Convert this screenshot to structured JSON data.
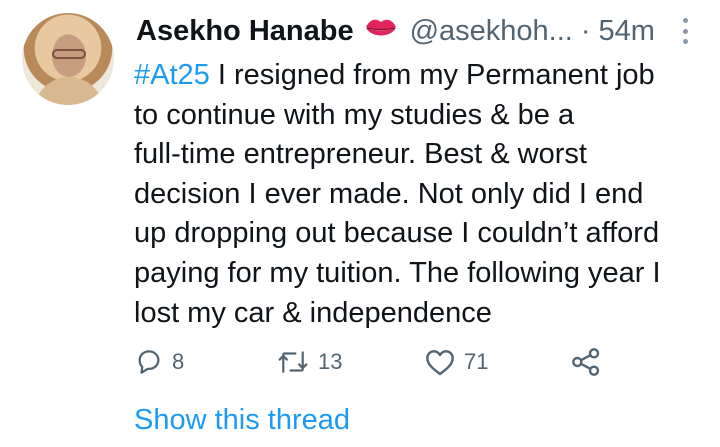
{
  "tweet": {
    "author_name": "Asekho Hanabe",
    "author_emoji_icon": "kiss-mark-icon",
    "handle": "@asekhoh...",
    "separator": "·",
    "time": "54m",
    "hashtag": "#At25",
    "lines": [
      " I resigned from my Permanent job",
      "to continue with my studies & be a",
      "full-time entrepreneur. Best & worst",
      "decision I ever made. Not only did I end",
      "up dropping out because I couldn’t afford",
      "paying for my tuition. The following year I",
      "lost my car & independence"
    ],
    "stats": {
      "replies": "8",
      "retweets": "13",
      "likes": "71"
    },
    "show_thread": "Show this thread"
  },
  "colors": {
    "link": "#1d9bf0",
    "text": "#0f1419",
    "muted": "#536471",
    "emoji": "#e0245e"
  }
}
